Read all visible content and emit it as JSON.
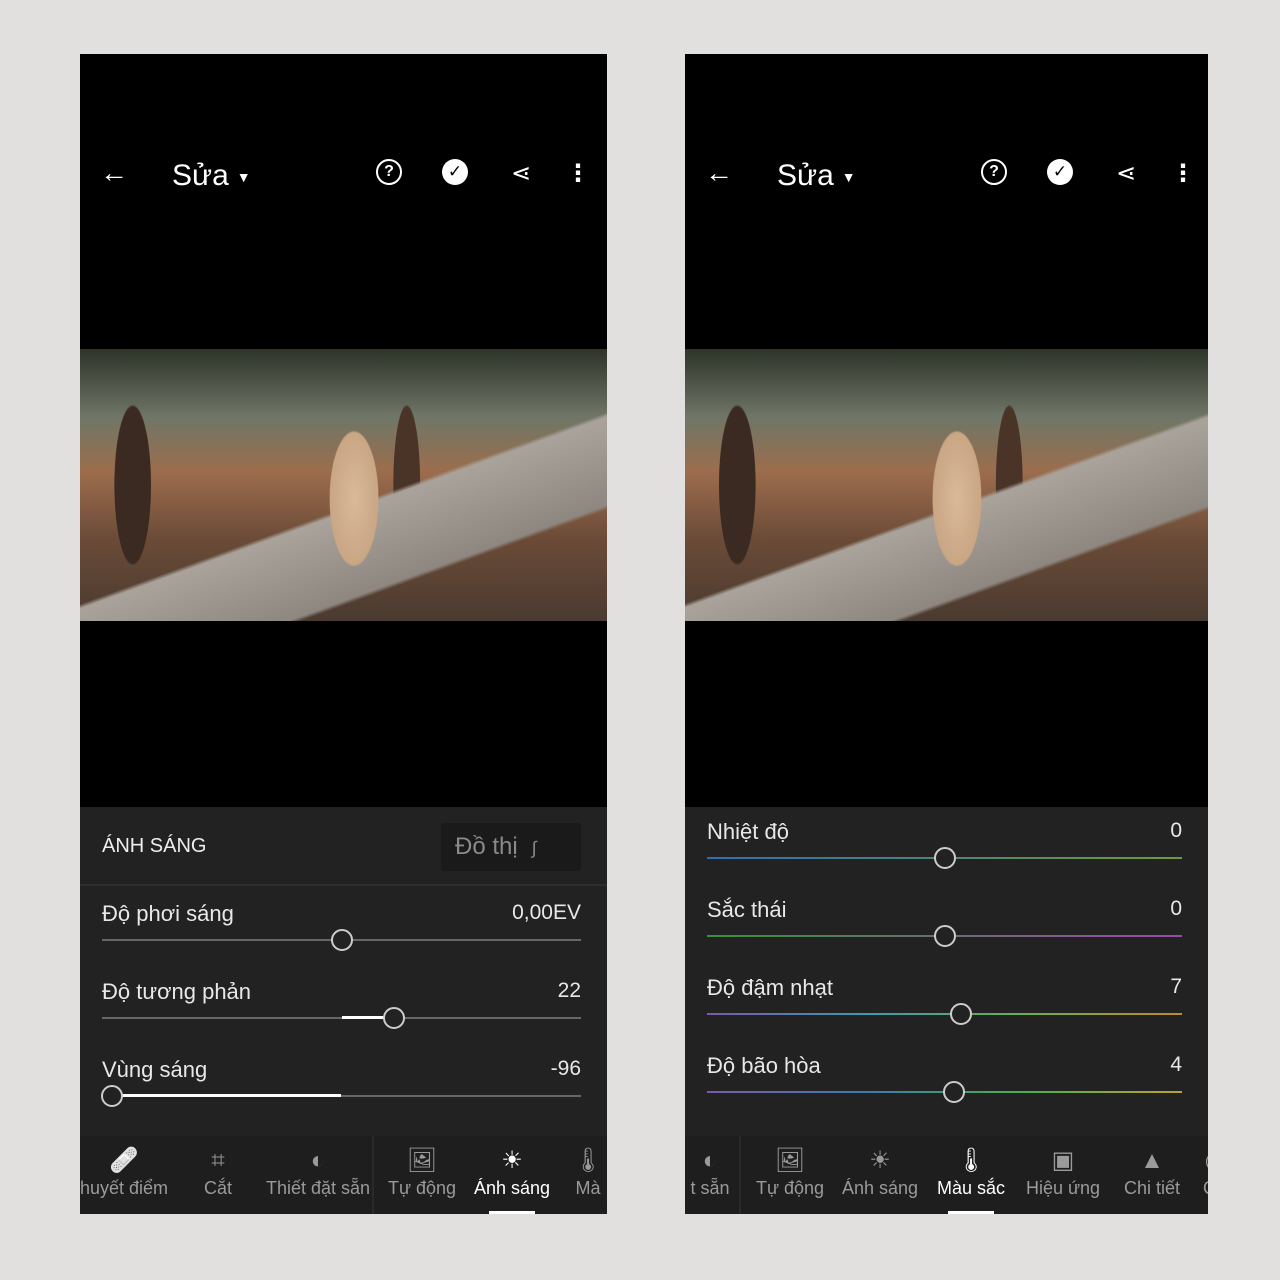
{
  "screens": [
    {
      "header": {
        "title": "Sửa",
        "back_icon": "arrow-left-icon",
        "icons": [
          "help-icon",
          "check-circle-icon",
          "share-icon",
          "more-vertical-icon"
        ]
      },
      "panel": {
        "section_title": "ÁNH SÁNG",
        "graph_button": "Đồ thị",
        "sliders": [
          {
            "label": "Độ phơi sáng",
            "value": "0,00EV",
            "level": 0
          },
          {
            "label": "Độ tương phản",
            "value": "22",
            "level": 22
          },
          {
            "label": "Vùng sáng",
            "value": "-96",
            "level": -96
          }
        ]
      },
      "toolbar": [
        {
          "label": "huyết điểm",
          "icon": "healing-icon"
        },
        {
          "label": "Cắt",
          "icon": "crop-icon"
        },
        {
          "label": "Thiết đặt sẵn",
          "icon": "presets-icon"
        },
        {
          "sep": true
        },
        {
          "label": "Tự động",
          "icon": "auto-icon"
        },
        {
          "label": "Ánh sáng",
          "icon": "sun-icon",
          "active": true
        },
        {
          "label": "Mà",
          "icon": "thermometer-icon"
        }
      ]
    },
    {
      "header": {
        "title": "Sửa",
        "back_icon": "arrow-left-icon",
        "icons": [
          "help-icon",
          "check-circle-icon",
          "share-icon",
          "more-vertical-icon"
        ]
      },
      "panel": {
        "sliders": [
          {
            "label": "Nhiệt độ",
            "value": "0",
            "level": 0,
            "gradient": [
              "#2f6fb0",
              "#6f9a3a"
            ]
          },
          {
            "label": "Sắc thái",
            "value": "0",
            "level": 0,
            "gradient": [
              "#3a8f3a",
              "#9a4aa8"
            ]
          },
          {
            "label": "Độ đậm nhạt",
            "value": "7",
            "level": 7,
            "gradient": [
              "#7a5aa8",
              "#3a9ab0",
              "#6ab04a",
              "#c08a30"
            ]
          },
          {
            "label": "Độ bão hòa",
            "value": "4",
            "level": 4,
            "gradient": [
              "#7a5aa8",
              "#3a7ab0",
              "#4ab04a",
              "#c0a030"
            ]
          }
        ]
      },
      "toolbar": [
        {
          "label": "t sẵn",
          "icon": "presets-icon"
        },
        {
          "sep": true
        },
        {
          "label": "Tự động",
          "icon": "auto-icon"
        },
        {
          "label": "Ánh sáng",
          "icon": "sun-icon"
        },
        {
          "label": "Màu sắc",
          "icon": "thermometer-icon",
          "active": true
        },
        {
          "label": "Hiệu ứng",
          "icon": "vignette-icon"
        },
        {
          "label": "Chi tiết",
          "icon": "detail-triangle-icon"
        },
        {
          "label": "Qu",
          "icon": "optics-icon"
        }
      ]
    }
  ]
}
